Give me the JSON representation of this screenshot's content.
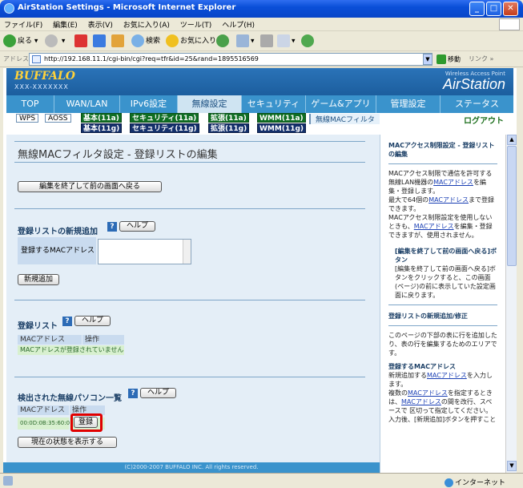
{
  "window": {
    "title": "AirStation Settings - Microsoft Internet Explorer"
  },
  "menu": [
    "ファイル(F)",
    "編集(E)",
    "表示(V)",
    "お気に入り(A)",
    "ツール(T)",
    "ヘルプ(H)"
  ],
  "toolbar": {
    "back": "戻る",
    "search": "検索",
    "favorites": "お気に入り"
  },
  "address": {
    "label": "アドレス(D)",
    "url": "http://192.168.11.1/cgi-bin/cgi?req=tfr&id=25&rand=1895516569",
    "go": "移動",
    "links": "リンク »"
  },
  "banner": {
    "brand": "BUFFALO",
    "brand_sub": "XXX-XXXXXXX",
    "tagline": "Wireless Access Point",
    "product": "AirStation"
  },
  "tabs": [
    "TOP",
    "WAN/LAN",
    "IPv6設定",
    "無線設定",
    "セキュリティ",
    "ゲーム&アプリ",
    "管理設定",
    "ステータス"
  ],
  "active_tab": "無線設定",
  "subnav": {
    "wps": "WPS",
    "aoss": "AOSS",
    "basic_a": "基本(11a)",
    "basic_g": "基本(11g)",
    "sec_a": "セキュリティ(11a)",
    "sec_g": "セキュリティ(11g)",
    "ext_a": "拡張(11a)",
    "ext_g": "拡張(11g)",
    "wmm_a": "WMM(11a)",
    "wmm_g": "WMM(11g)",
    "mac_filter": "無線MACフィルタ",
    "logout": "ログアウト"
  },
  "main": {
    "title": "無線MACフィルタ設定 - 登録リストの編集",
    "back_button": "編集を終了して前の画面へ戻る",
    "add_section": "登録リストの新規追加",
    "help": "ヘルプ",
    "mac_label": "登録するMACアドレス",
    "add_button": "新規追加",
    "list_section": "登録リスト",
    "col_mac": "MACアドレス",
    "col_op": "操作",
    "empty_message": "MACアドレスが登録されていません",
    "detected_section": "検出された無線パソコン一覧",
    "detected_mac": "00:0D:0B:35:60:06",
    "register_button": "登録",
    "refresh_button": "現在の状態を表示する"
  },
  "copyright": "(C)2000-2007 BUFFALO INC. All rights reserved.",
  "side": {
    "h1": "MACアクセス制限設定 - 登録リストの編集",
    "p1a": "MACアクセス制限で通信を許可する無線LAN機器の",
    "p1link": "MACアドレス",
    "p1b": "を編集・登録します。",
    "p2a": "最大で64個の",
    "p2b": "まで登録できます。",
    "p3a": "MACアクセス制限設定を使用しないときも、",
    "p3b": "を編集・登録できますが、使用されません。",
    "h2": "[編集を終了して前の画面へ戻る]ボタン",
    "p4": "[編集を終了して前の画面へ戻る]ボタンをクリックすると、この画面(ページ)の前に表示していた設定画面に戻ります。",
    "h3": "登録リストの新規追加/修正",
    "p5": "このページの下部の表に行を追加したり、表の行を編集するためのエリアです。",
    "h4": "登録するMACアドレス",
    "p6a": "新規追加する",
    "p6b": "を入力します。",
    "p7a": "複数の",
    "p7b": "を指定するときは、",
    "p7c": "の間を改行、スペースで 区切って指定してください。",
    "p8": "入力後、[新規追加]ボタンを押すこと"
  },
  "status": {
    "zone": "インターネット"
  }
}
